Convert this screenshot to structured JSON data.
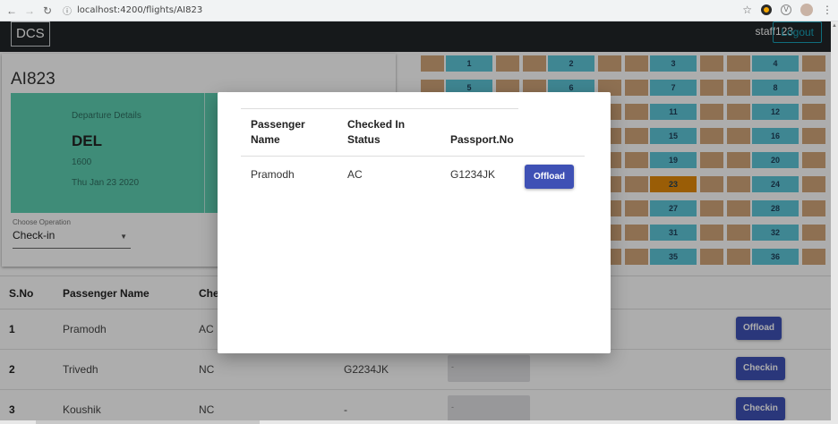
{
  "browser": {
    "url": "localhost:4200/flights/AI823",
    "back_icon": "arrow-left-icon",
    "forward_icon": "arrow-right-icon",
    "reload_icon": "reload-icon"
  },
  "header": {
    "brand": "DCS",
    "user": "staff123",
    "logout_label": "Logout"
  },
  "flight": {
    "code": "AI823",
    "departure": {
      "label": "Departure Details",
      "airport": "DEL",
      "time": "1600",
      "date": "Thu Jan 23 2020"
    },
    "operation": {
      "label": "Choose Operation",
      "value": "Check-in"
    }
  },
  "seats": [
    [
      "1",
      "2",
      "3",
      "4"
    ],
    [
      "5",
      "6",
      "7",
      "8"
    ],
    [
      "",
      "",
      "11",
      "12"
    ],
    [
      "",
      "",
      "15",
      "16"
    ],
    [
      "",
      "",
      "19",
      "20"
    ],
    [
      "",
      "",
      "23",
      "24"
    ],
    [
      "",
      "",
      "27",
      "28"
    ],
    [
      "",
      "",
      "31",
      "32"
    ],
    [
      "",
      "",
      "35",
      "36"
    ]
  ],
  "seat_highlight": "23",
  "colors": {
    "seat_tan": "#d2a679",
    "seat_blue": "#5ec6d8",
    "seat_selected": "#e38a0a",
    "departure_panel": "#5ecfb1",
    "primary_button": "#3f51b5"
  },
  "table": {
    "headers": {
      "sno": "S.No",
      "name": "Passenger Name",
      "status": "Che"
    },
    "rows": [
      {
        "sno": "1",
        "name": "Pramodh",
        "status": "AC",
        "passport": "",
        "input": "",
        "action": "Offload"
      },
      {
        "sno": "2",
        "name": "Trivedh",
        "status": "NC",
        "passport": "G2234JK",
        "input": "-",
        "action": "Checkin"
      },
      {
        "sno": "3",
        "name": "Koushik",
        "status": "NC",
        "passport": "-",
        "input": "-",
        "action": "Checkin"
      }
    ]
  },
  "modal": {
    "headers": {
      "name": "Passenger Name",
      "status": "Checked In Status",
      "passport": "Passport.No"
    },
    "row": {
      "name": "Pramodh",
      "status": "AC",
      "passport": "G1234JK",
      "action": "Offload"
    }
  }
}
